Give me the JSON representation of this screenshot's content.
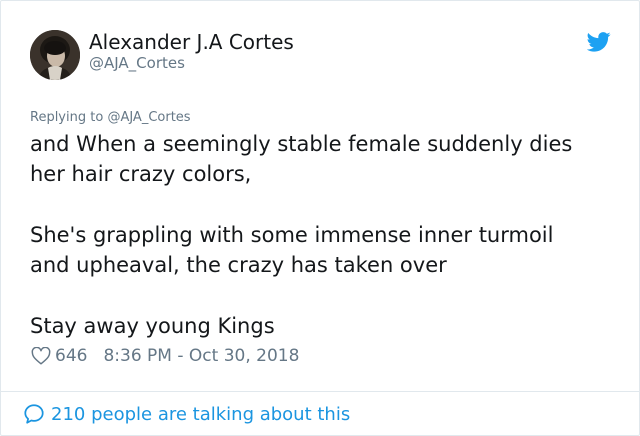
{
  "author": {
    "name": "Alexander J.A Cortes",
    "handle": "@AJA_Cortes"
  },
  "reply": {
    "prefix": "Replying to",
    "target": "@AJA_Cortes"
  },
  "tweet": {
    "line1": "and When a seemingly stable female suddenly dies",
    "line2": "her hair crazy colors,",
    "line3": "She's grappling with some immense inner turmoil",
    "line4": "and upheaval, the crazy has taken over",
    "line5": "Stay away young Kings"
  },
  "meta": {
    "likes": "646",
    "timestamp": "8:36 PM - Oct 30, 2018"
  },
  "footer": {
    "talking": "210 people are talking about this"
  },
  "colors": {
    "brand": "#1da1f2",
    "link": "#1b95e0",
    "muted": "#657786",
    "text": "#14171a"
  },
  "icons": {
    "logo": "twitter-bird-icon",
    "like": "heart-icon",
    "talk": "speech-bubble-icon"
  }
}
